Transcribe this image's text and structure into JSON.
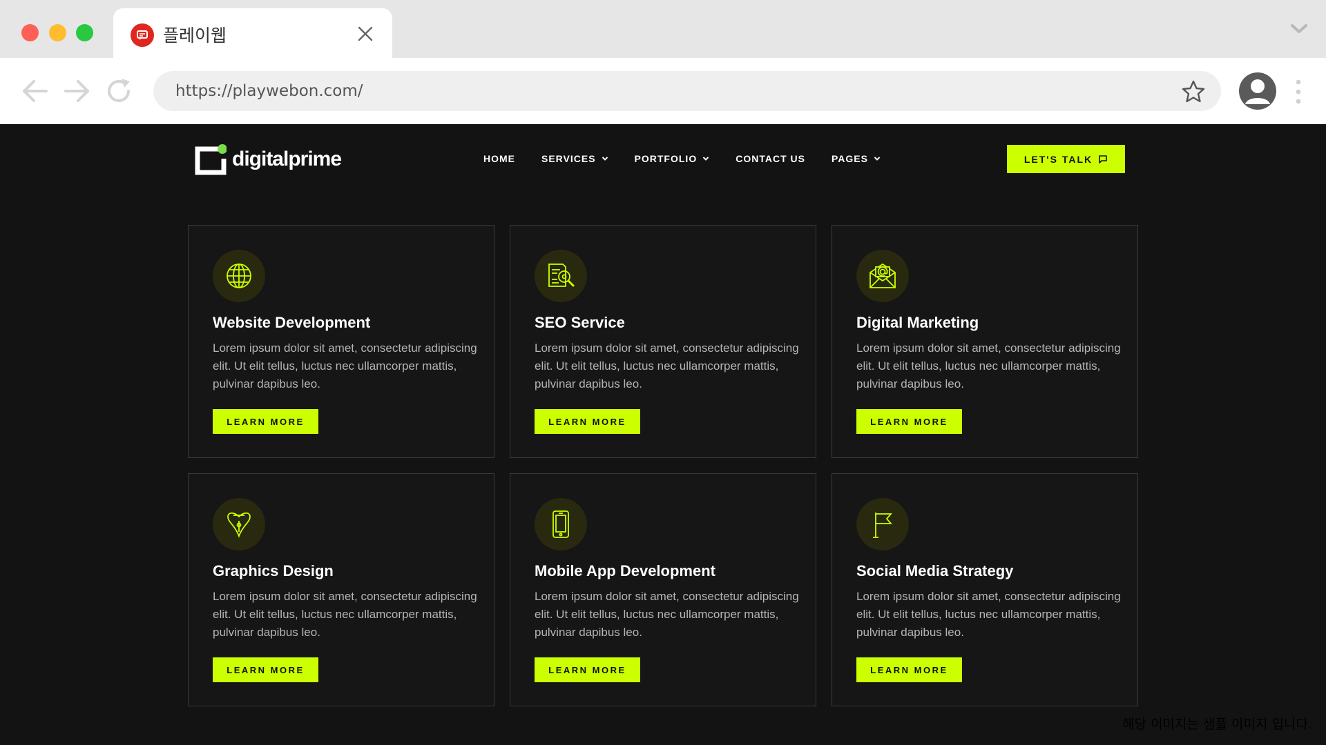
{
  "browser": {
    "tab_title": "플레이웹",
    "url": "https://playwebon.com/"
  },
  "site": {
    "logo_text": "digitalprime",
    "nav": [
      {
        "label": "HOME",
        "dropdown": false
      },
      {
        "label": "SERVICES",
        "dropdown": true
      },
      {
        "label": "PORTFOLIO",
        "dropdown": true
      },
      {
        "label": "CONTACT US",
        "dropdown": false
      },
      {
        "label": "PAGES",
        "dropdown": true
      }
    ],
    "cta_label": "LET'S TALK",
    "accent_color": "#ccff00"
  },
  "services": [
    {
      "title": "Website Development",
      "icon": "globe-icon",
      "description": "Lorem ipsum dolor sit amet, consectetur adipiscing elit. Ut elit tellus, luctus nec ullamcorper mattis, pulvinar dapibus leo.",
      "button": "LEARN MORE"
    },
    {
      "title": "SEO Service",
      "icon": "seo-search-icon",
      "description": "Lorem ipsum dolor sit amet, consectetur adipiscing elit. Ut elit tellus, luctus nec ullamcorper mattis, pulvinar dapibus leo.",
      "button": "LEARN MORE"
    },
    {
      "title": "Digital Marketing",
      "icon": "email-envelope-icon",
      "description": "Lorem ipsum dolor sit amet, consectetur adipiscing elit. Ut elit tellus, luctus nec ullamcorper mattis, pulvinar dapibus leo.",
      "button": "LEARN MORE"
    },
    {
      "title": "Graphics Design",
      "icon": "pen-nib-icon",
      "description": "Lorem ipsum dolor sit amet, consectetur adipiscing elit. Ut elit tellus, luctus nec ullamcorper mattis, pulvinar dapibus leo.",
      "button": "LEARN MORE"
    },
    {
      "title": "Mobile App Development",
      "icon": "smartphone-icon",
      "description": "Lorem ipsum dolor sit amet, consectetur adipiscing elit. Ut elit tellus, luctus nec ullamcorper mattis, pulvinar dapibus leo.",
      "button": "LEARN MORE"
    },
    {
      "title": "Social Media Strategy",
      "icon": "flag-icon",
      "description": "Lorem ipsum dolor sit amet, consectetur adipiscing elit. Ut elit tellus, luctus nec ullamcorper mattis, pulvinar dapibus leo.",
      "button": "LEARN MORE"
    }
  ],
  "watermark": "해당 이미지는 샘플 이미지 입니다."
}
